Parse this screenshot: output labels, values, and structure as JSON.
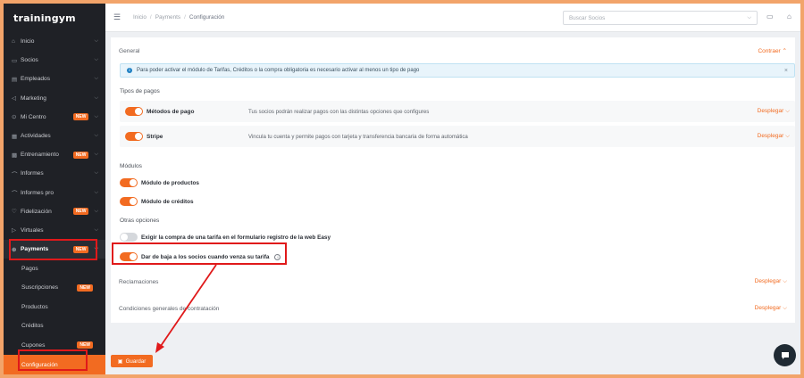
{
  "brand": {
    "logo": "trainingym",
    "accent": "#f26b21",
    "highlight": "#e0191a"
  },
  "sidebar": {
    "items": [
      {
        "icon": "⌂",
        "label": "Inicio",
        "badge": ""
      },
      {
        "icon": "▭",
        "label": "Socios",
        "badge": ""
      },
      {
        "icon": "▤",
        "label": "Empleados",
        "badge": ""
      },
      {
        "icon": "◁",
        "label": "Marketing",
        "badge": ""
      },
      {
        "icon": "⊙",
        "label": "Mi Centro",
        "badge": "NEW"
      },
      {
        "icon": "▦",
        "label": "Actividades",
        "badge": ""
      },
      {
        "icon": "▩",
        "label": "Entrenamiento",
        "badge": "NEW"
      },
      {
        "icon": "⌒",
        "label": "Informes",
        "badge": ""
      },
      {
        "icon": "⌒",
        "label": "Informes pro",
        "badge": ""
      },
      {
        "icon": "♡",
        "label": "Fidelización",
        "badge": "NEW"
      },
      {
        "icon": "▷",
        "label": "Virtuales",
        "badge": ""
      },
      {
        "icon": "⊛",
        "label": "Payments",
        "badge": "NEW"
      }
    ],
    "payments_sub": [
      {
        "label": "Pagos",
        "badge": ""
      },
      {
        "label": "Suscripciones",
        "badge": "NEW"
      },
      {
        "label": "Productos",
        "badge": ""
      },
      {
        "label": "Créditos",
        "badge": ""
      },
      {
        "label": "Cupones",
        "badge": "NEW"
      },
      {
        "label": "Configuración",
        "badge": ""
      }
    ]
  },
  "topbar": {
    "breadcrumb": [
      "Inicio",
      "Payments",
      "Configuración"
    ],
    "search_placeholder": "Buscar Socios"
  },
  "general": {
    "title": "General",
    "collapse_label": "Contraer",
    "alert": "Para poder activar el módulo de Tarifas, Créditos o la compra obligatoria es necesario activar al menos un tipo de pago",
    "tipos_title": "Tipos de pagos",
    "payment_types": [
      {
        "name": "Métodos de pago",
        "description": "Tus socios podrán realizar pagos con las distintas opciones que configures",
        "action": "Desplegar",
        "enabled": true
      },
      {
        "name": "Stripe",
        "description": "Vincula tu cuenta y permite pagos con tarjeta y transferencia bancaria de forma automática",
        "action": "Desplegar",
        "enabled": true
      }
    ],
    "modulos_title": "Módulos",
    "modulos": [
      {
        "label": "Módulo de productos",
        "enabled": true
      },
      {
        "label": "Módulo de créditos",
        "enabled": true
      }
    ],
    "otras_title": "Otras opciones",
    "otras": [
      {
        "label": "Exigir la compra de una tarifa en el formulario registro de la web Easy",
        "enabled": false
      },
      {
        "label": "Dar de baja a los socios cuando venza su tarifa",
        "enabled": true
      }
    ]
  },
  "sections": [
    {
      "title": "Reclamaciones",
      "action": "Desplegar"
    },
    {
      "title": "Condiciones generales de contratación",
      "action": "Desplegar"
    }
  ],
  "save_label": "Guardar"
}
